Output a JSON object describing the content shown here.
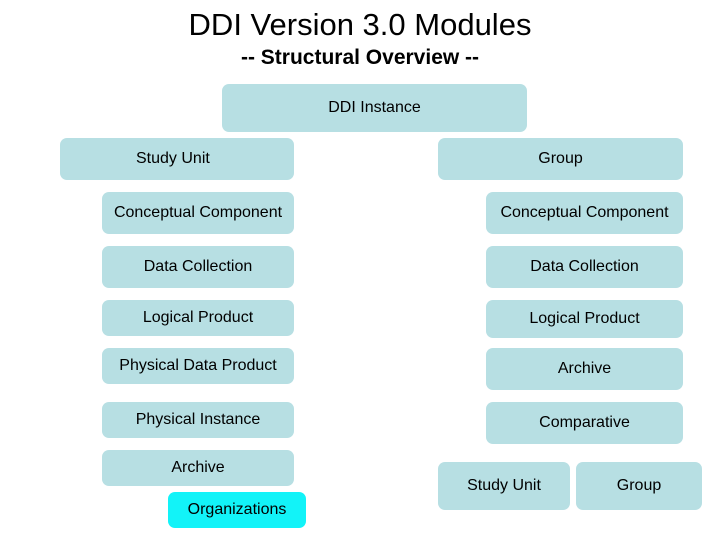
{
  "title": "DDI Version 3.0 Modules",
  "subtitle": "-- Structural Overview --",
  "colors": {
    "box": "#b7dfe3",
    "highlight": "#12f3f8"
  },
  "root": {
    "label": "DDI Instance"
  },
  "study_unit": {
    "label": "Study Unit",
    "modules": [
      {
        "label": "Conceptual Component"
      },
      {
        "label": "Data Collection"
      },
      {
        "label": "Logical Product"
      },
      {
        "label": "Physical Data Product"
      },
      {
        "label": "Physical Instance"
      },
      {
        "label": "Archive"
      }
    ],
    "extra": {
      "label": "Organizations"
    }
  },
  "group": {
    "label": "Group",
    "modules": [
      {
        "label": "Conceptual Component"
      },
      {
        "label": "Data Collection"
      },
      {
        "label": "Logical Product"
      },
      {
        "label": "Archive"
      },
      {
        "label": "Comparative"
      }
    ],
    "children": [
      {
        "label": "Study Unit"
      },
      {
        "label": "Group"
      }
    ]
  }
}
